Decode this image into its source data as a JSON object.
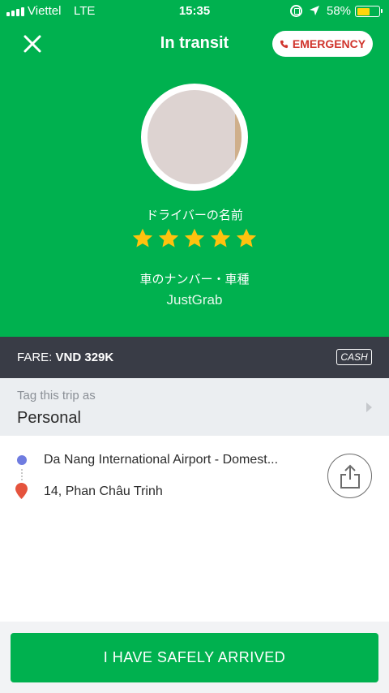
{
  "status_bar": {
    "carrier": "Viettel",
    "network": "LTE",
    "time": "15:35",
    "battery_percent": "58%",
    "battery_level": 0.58,
    "battery_color": "#ffd60a",
    "icons": [
      "signal-icon",
      "orientation-lock-icon",
      "location-arrow-icon",
      "battery-icon"
    ]
  },
  "header": {
    "title": "In transit",
    "emergency_label": "EMERGENCY",
    "close_icon": "close-icon",
    "emergency_icon": "phone-icon"
  },
  "driver": {
    "name": "ドライバーの名前",
    "rating": 5,
    "rating_max": 5,
    "plate_vehicle": "車のナンバー・車種",
    "service": "JustGrab"
  },
  "fare": {
    "label": "FARE:",
    "amount": "VND 329K",
    "payment": "CASH"
  },
  "tag": {
    "label": "Tag this trip as",
    "value": "Personal"
  },
  "route": {
    "pickup": "Da Nang International Airport - Domest...",
    "dropoff": "14, Phan Châu Trinh",
    "share_icon": "share-icon"
  },
  "action": {
    "arrived_label": "I HAVE SAFELY ARRIVED"
  },
  "colors": {
    "brand_green": "#00b14f",
    "fare_bar": "#393c46",
    "emergency_red": "#d0342c",
    "star": "#ffc20e",
    "pickup_dot": "#6f7ce0",
    "dropoff_pin": "#e5533d"
  }
}
